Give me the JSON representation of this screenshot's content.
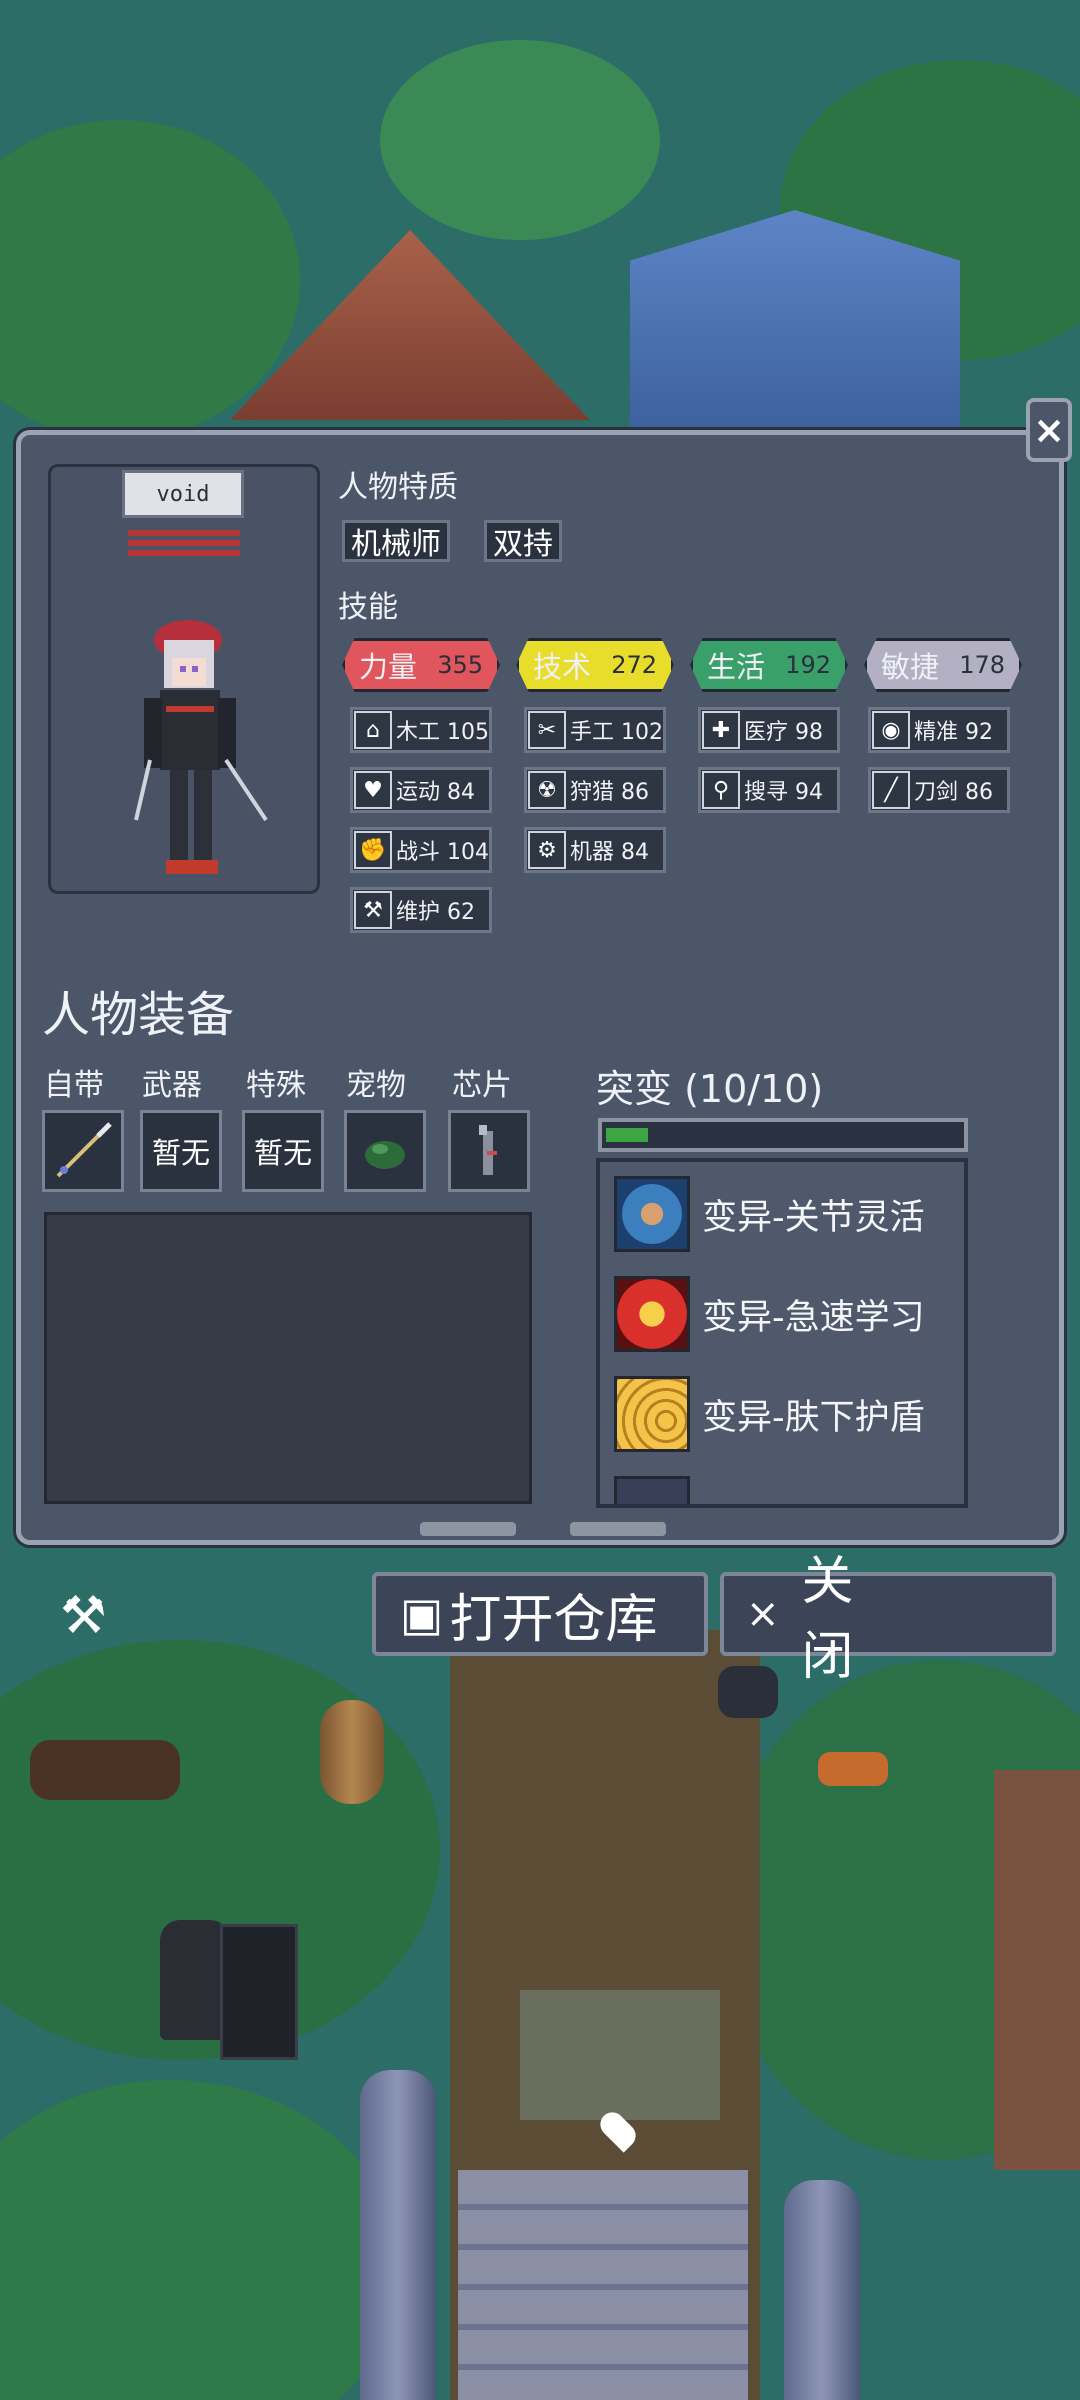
{
  "character": {
    "name": "void"
  },
  "traits": {
    "title": "人物特质",
    "items": [
      "机械师",
      "双持"
    ]
  },
  "skills": {
    "title": "技能",
    "stats": [
      {
        "label": "力量",
        "value": "355",
        "color": "#e0565c"
      },
      {
        "label": "技术",
        "value": "272",
        "color": "#e8dd2b"
      },
      {
        "label": "生活",
        "value": "192",
        "color": "#39a06a"
      },
      {
        "label": "敏捷",
        "value": "178",
        "color": "#b3b0c4"
      }
    ],
    "items": [
      {
        "icon": "house-icon",
        "glyph": "⌂",
        "label": "木工 105"
      },
      {
        "icon": "scissors-icon",
        "glyph": "✂",
        "label": "手工 102"
      },
      {
        "icon": "medkit-icon",
        "glyph": "✚",
        "label": "医疗 98"
      },
      {
        "icon": "eye-icon",
        "glyph": "◉",
        "label": "精准 92"
      },
      {
        "icon": "heart-icon",
        "glyph": "♥",
        "label": "运动 84"
      },
      {
        "icon": "radiation-icon",
        "glyph": "☢",
        "label": "狩猎 86"
      },
      {
        "icon": "magnifier-icon",
        "glyph": "⚲",
        "label": "搜寻 94"
      },
      {
        "icon": "blade-icon",
        "glyph": "╱",
        "label": "刀剑 86"
      },
      {
        "icon": "fist-icon",
        "glyph": "✊",
        "label": "战斗 104"
      },
      {
        "icon": "gear-icon",
        "glyph": "⚙",
        "label": "机器 84"
      },
      {
        "icon": "wrench-icon",
        "glyph": "⚒",
        "label": "维护 62"
      }
    ]
  },
  "equipment": {
    "title": "人物装备",
    "slots": [
      {
        "label": "自带",
        "value": ""
      },
      {
        "label": "武器",
        "value": "暂无"
      },
      {
        "label": "特殊",
        "value": "暂无"
      },
      {
        "label": "宠物",
        "value": ""
      },
      {
        "label": "芯片",
        "value": ""
      }
    ]
  },
  "mutation": {
    "title": "突变 (10/10)",
    "progress": 0.12,
    "items": [
      {
        "icon": "joint-flex-icon",
        "label": "变异-关节灵活"
      },
      {
        "icon": "fast-learning-icon",
        "label": "变异-急速学习"
      },
      {
        "icon": "skin-shield-icon",
        "label": "变异-肤下护盾"
      }
    ]
  },
  "buttons": {
    "open_storage": "打开仓库",
    "close": "关　闭",
    "close_x": "×"
  }
}
